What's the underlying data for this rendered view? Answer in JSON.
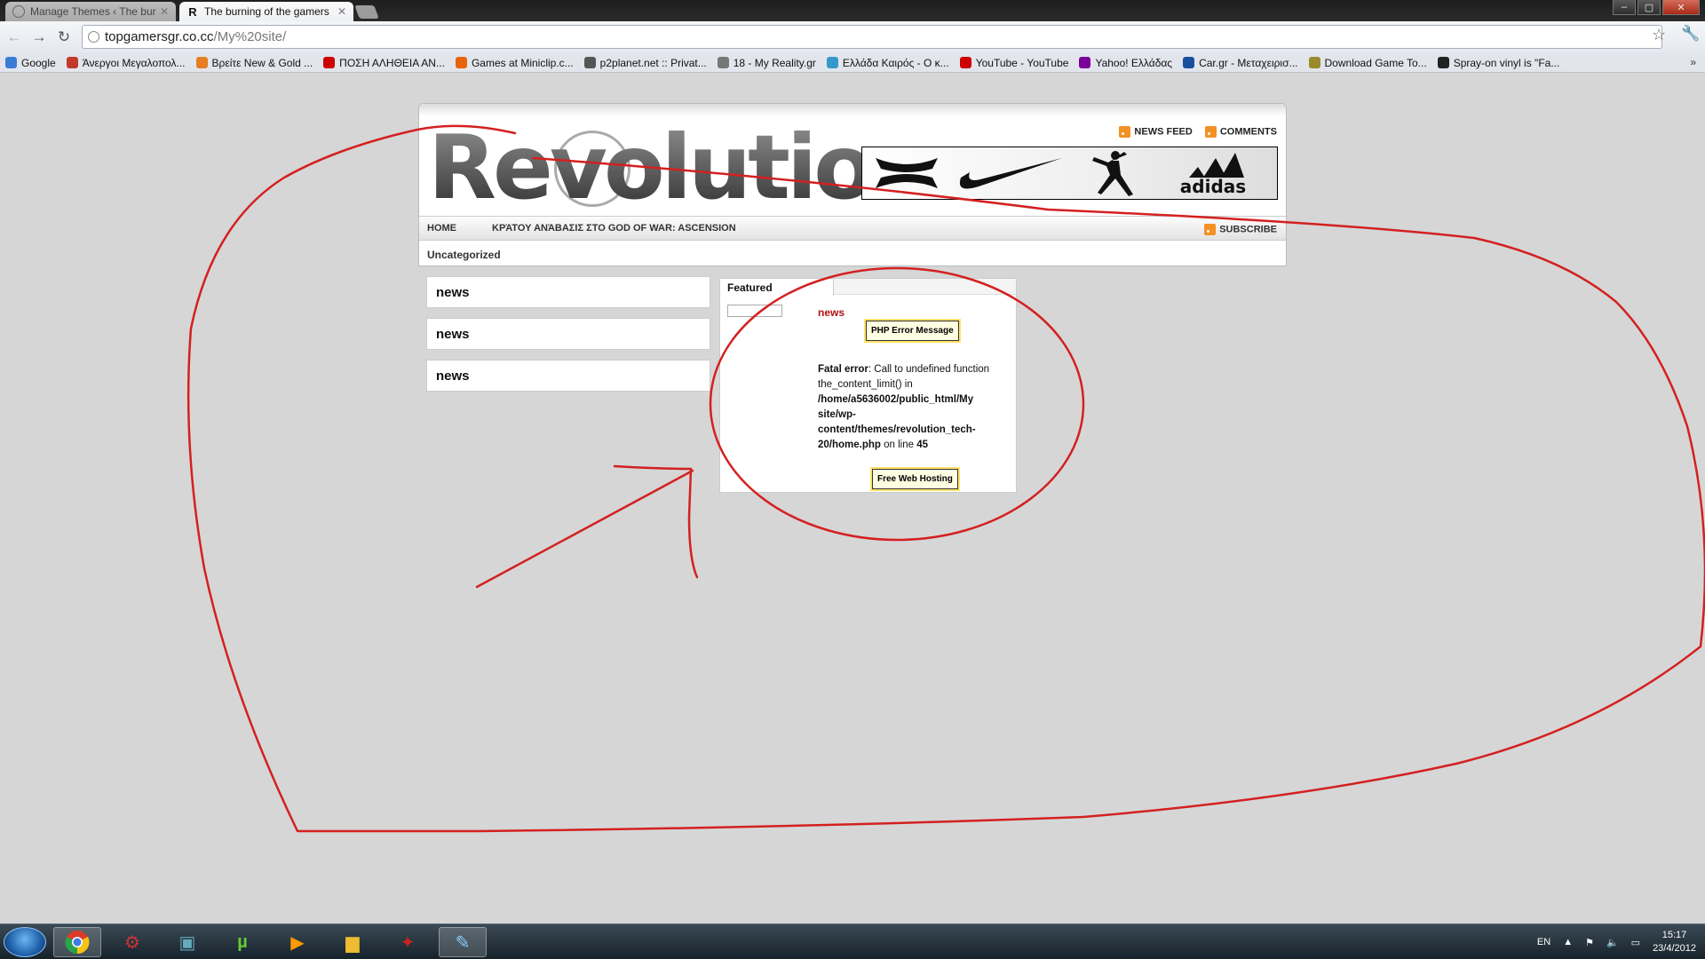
{
  "browser": {
    "tabs": [
      {
        "label": "Manage Themes ‹ The burn",
        "active": false
      },
      {
        "label": "The burning of the gamers",
        "active": true
      }
    ],
    "url_host": "topgamersgr.co.cc",
    "url_path": "/My%20site/",
    "bookmarks": [
      {
        "label": "Google",
        "color": "#3a7bd5"
      },
      {
        "label": "Άνεργοι Μεγαλοπολ...",
        "color": "#c0392b"
      },
      {
        "label": "Βρείτε New & Gold ...",
        "color": "#e67e22"
      },
      {
        "label": "ΠΟΣΗ ΑΛΗΘΕΙΑ ΑΝ...",
        "color": "#cc0000"
      },
      {
        "label": "Games at Miniclip.c...",
        "color": "#e8630a"
      },
      {
        "label": "p2planet.net :: Privat...",
        "color": "#555555"
      },
      {
        "label": "18 - My Reality.gr",
        "color": "#777777"
      },
      {
        "label": "Ελλάδα Καιρός - Ο κ...",
        "color": "#3399cc"
      },
      {
        "label": "YouTube - YouTube",
        "color": "#cc0000"
      },
      {
        "label": "Yahoo! Ελλάδας",
        "color": "#7b0099"
      },
      {
        "label": "Car.gr - Μεταχειρισ...",
        "color": "#1a4fa0"
      },
      {
        "label": "Download Game To...",
        "color": "#9a8a2a"
      },
      {
        "label": "Spray-on vinyl is \"Fa...",
        "color": "#222222"
      }
    ]
  },
  "site": {
    "logo_text": "Revolution",
    "header_links": {
      "news_feed": "NEWS FEED",
      "comments": "COMMENTS"
    },
    "banner_brands": [
      "Under Armour",
      "Nike",
      "Jordan",
      "adidas"
    ],
    "banner_text": "adidas",
    "nav": {
      "home": "HOME",
      "page": "ΚΡΆΤΟΥ ΑΝΆΒΑΣΙΣ ΣΤΟ GOD OF WAR: ASCENSION",
      "subscribe": "SUBSCRIBE"
    },
    "category": "Uncategorized",
    "sidebar_news": [
      "news",
      "news",
      "news"
    ],
    "featured": {
      "tab": "Featured",
      "title": "news",
      "error_button": "PHP Error Message",
      "fatal_label": "Fatal error",
      "fatal_msg": ": Call to undefined function the_content_limit() in ",
      "fatal_path": "/home/a5636002/public_html/My site/wp-content/themes/revolution_tech-20/home.php",
      "fatal_on_line": " on line ",
      "fatal_line": "45",
      "hosting_button": "Free Web Hosting"
    }
  },
  "annotation_color": "#d42020",
  "taskbar": {
    "lang": "EN",
    "time": "15:17",
    "date": "23/4/2012"
  }
}
